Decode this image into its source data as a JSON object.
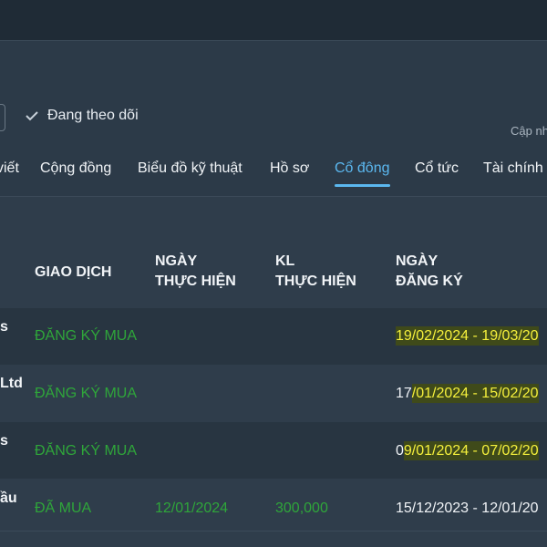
{
  "follow": {
    "label": "Đang theo dõi"
  },
  "update": {
    "label": "Cập nh"
  },
  "tabs": [
    {
      "label": "viết"
    },
    {
      "label": "Cộng đồng"
    },
    {
      "label": "Biểu đồ kỹ thuật"
    },
    {
      "label": "Hồ sơ"
    },
    {
      "label": "Cổ đông",
      "active": true
    },
    {
      "label": "Cổ tức"
    },
    {
      "label": "Tài chính"
    }
  ],
  "table": {
    "headers": {
      "transaction": "GIAO DỊCH",
      "date_line1": "NGÀY",
      "date_line2": "THỰC HIỆN",
      "volume_line1": "KL",
      "volume_line2": "THỰC HIỆN",
      "reg_line1": "NGÀY",
      "reg_line2": "ĐĂNG KÝ"
    },
    "rows": [
      {
        "name": "s",
        "transaction": "ĐĂNG KÝ MUA",
        "exec_date": "",
        "volume": "",
        "reg_prefix": "",
        "reg_range": "19/02/2024 - 19/03/20"
      },
      {
        "name": "Ltd",
        "transaction": "ĐĂNG KÝ MUA",
        "exec_date": "",
        "volume": "",
        "reg_prefix": "17",
        "reg_range": "/01/2024 - 15/02/20"
      },
      {
        "name": "s",
        "transaction": "ĐĂNG KÝ MUA",
        "exec_date": "",
        "volume": "",
        "reg_prefix": "0",
        "reg_range": "9/01/2024 - 07/02/20"
      },
      {
        "name": "ầu",
        "transaction": "ĐÃ MUA",
        "exec_date": "12/01/2024",
        "volume": "300,000",
        "reg_prefix": "15/12/2023 - 12/01/20",
        "reg_range": ""
      }
    ]
  },
  "colors": {
    "accent": "#5bb8f0",
    "buy": "#2fa63a",
    "highlight": "#f5f03c"
  }
}
